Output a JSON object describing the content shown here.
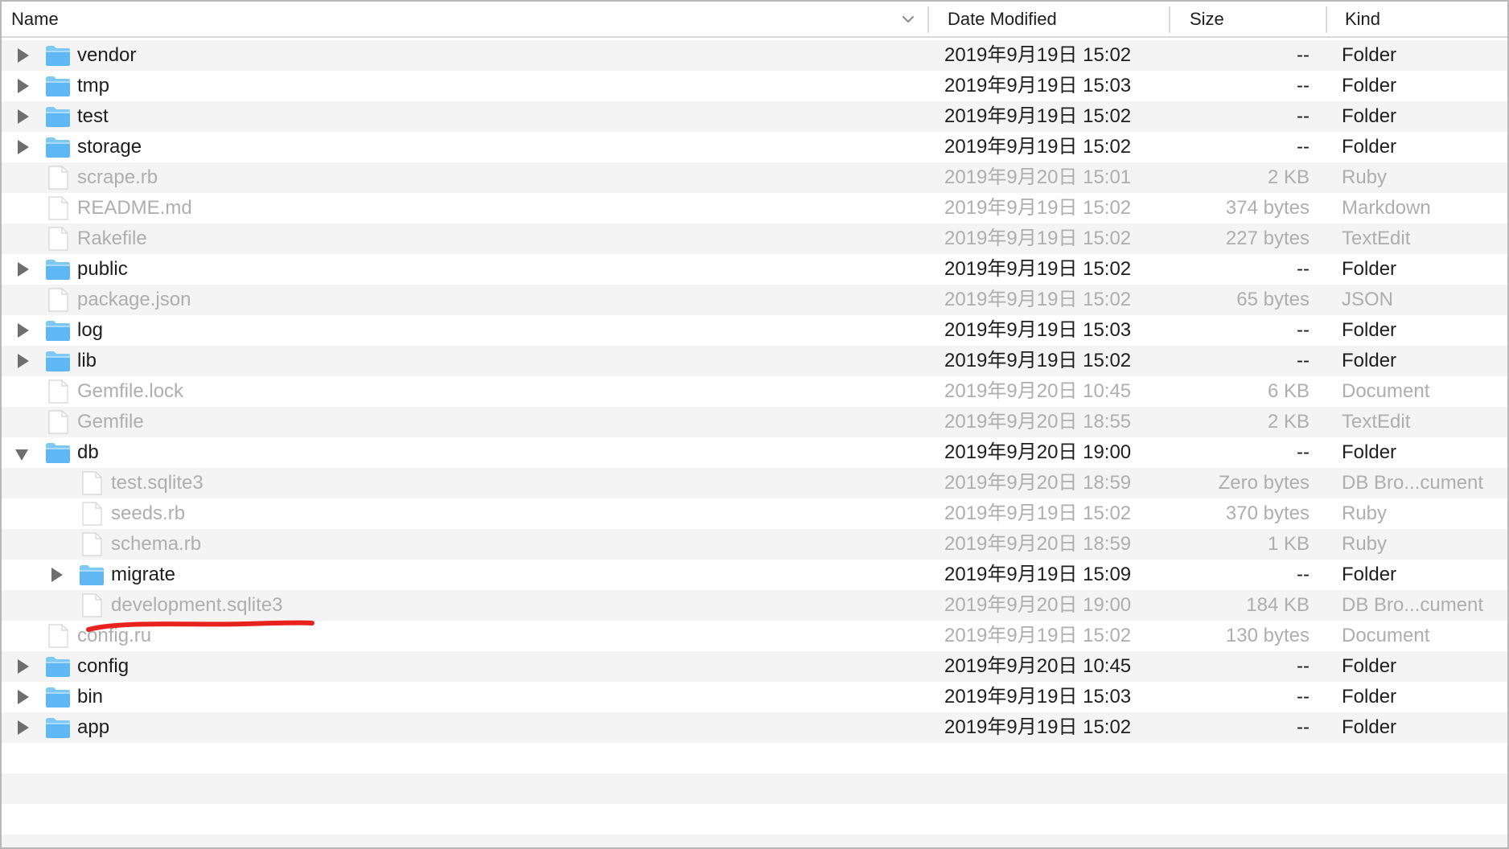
{
  "columns": {
    "name": "Name",
    "date_modified": "Date Modified",
    "size": "Size",
    "kind": "Kind"
  },
  "colors": {
    "folder": "#5fb8f3",
    "folder_tab": "#7ec8f6",
    "row_stripe": "#f4f4f4",
    "dimmed_text": "#aeaeae",
    "annotation": "#e8231d"
  },
  "rows": [
    {
      "name": "vendor",
      "date": "2019年9月19日 15:02",
      "size": "--",
      "kind": "Folder",
      "type": "folder",
      "level": 0,
      "expanded": false,
      "dim": false
    },
    {
      "name": "tmp",
      "date": "2019年9月19日 15:03",
      "size": "--",
      "kind": "Folder",
      "type": "folder",
      "level": 0,
      "expanded": false,
      "dim": false
    },
    {
      "name": "test",
      "date": "2019年9月19日 15:02",
      "size": "--",
      "kind": "Folder",
      "type": "folder",
      "level": 0,
      "expanded": false,
      "dim": false
    },
    {
      "name": "storage",
      "date": "2019年9月19日 15:02",
      "size": "--",
      "kind": "Folder",
      "type": "folder",
      "level": 0,
      "expanded": false,
      "dim": false
    },
    {
      "name": "scrape.rb",
      "date": "2019年9月20日 15:01",
      "size": "2 KB",
      "kind": "Ruby",
      "type": "file",
      "level": 0,
      "dim": true
    },
    {
      "name": "README.md",
      "date": "2019年9月19日 15:02",
      "size": "374 bytes",
      "kind": "Markdown",
      "type": "file",
      "level": 0,
      "dim": true
    },
    {
      "name": "Rakefile",
      "date": "2019年9月19日 15:02",
      "size": "227 bytes",
      "kind": "TextEdit",
      "type": "file",
      "level": 0,
      "dim": true
    },
    {
      "name": "public",
      "date": "2019年9月19日 15:02",
      "size": "--",
      "kind": "Folder",
      "type": "folder",
      "level": 0,
      "expanded": false,
      "dim": false
    },
    {
      "name": "package.json",
      "date": "2019年9月19日 15:02",
      "size": "65 bytes",
      "kind": "JSON",
      "type": "file",
      "level": 0,
      "dim": true
    },
    {
      "name": "log",
      "date": "2019年9月19日 15:03",
      "size": "--",
      "kind": "Folder",
      "type": "folder",
      "level": 0,
      "expanded": false,
      "dim": false
    },
    {
      "name": "lib",
      "date": "2019年9月19日 15:02",
      "size": "--",
      "kind": "Folder",
      "type": "folder",
      "level": 0,
      "expanded": false,
      "dim": false
    },
    {
      "name": "Gemfile.lock",
      "date": "2019年9月20日 10:45",
      "size": "6 KB",
      "kind": "Document",
      "type": "file",
      "level": 0,
      "dim": true
    },
    {
      "name": "Gemfile",
      "date": "2019年9月20日 18:55",
      "size": "2 KB",
      "kind": "TextEdit",
      "type": "file",
      "level": 0,
      "dim": true
    },
    {
      "name": "db",
      "date": "2019年9月20日 19:00",
      "size": "--",
      "kind": "Folder",
      "type": "folder",
      "level": 0,
      "expanded": true,
      "dim": false
    },
    {
      "name": "test.sqlite3",
      "date": "2019年9月20日 18:59",
      "size": "Zero bytes",
      "kind": "DB Bro...cument",
      "type": "file",
      "level": 1,
      "dim": true
    },
    {
      "name": "seeds.rb",
      "date": "2019年9月19日 15:02",
      "size": "370 bytes",
      "kind": "Ruby",
      "type": "file",
      "level": 1,
      "dim": true
    },
    {
      "name": "schema.rb",
      "date": "2019年9月20日 18:59",
      "size": "1 KB",
      "kind": "Ruby",
      "type": "file",
      "level": 1,
      "dim": true
    },
    {
      "name": "migrate",
      "date": "2019年9月19日 15:09",
      "size": "--",
      "kind": "Folder",
      "type": "folder",
      "level": 1,
      "expanded": false,
      "dim": false
    },
    {
      "name": "development.sqlite3",
      "date": "2019年9月20日 19:00",
      "size": "184 KB",
      "kind": "DB Bro...cument",
      "type": "file",
      "level": 1,
      "dim": true,
      "annotated": true
    },
    {
      "name": "config.ru",
      "date": "2019年9月19日 15:02",
      "size": "130 bytes",
      "kind": "Document",
      "type": "file",
      "level": 0,
      "dim": true
    },
    {
      "name": "config",
      "date": "2019年9月20日 10:45",
      "size": "--",
      "kind": "Folder",
      "type": "folder",
      "level": 0,
      "expanded": false,
      "dim": false
    },
    {
      "name": "bin",
      "date": "2019年9月19日 15:03",
      "size": "--",
      "kind": "Folder",
      "type": "folder",
      "level": 0,
      "expanded": false,
      "dim": false
    },
    {
      "name": "app",
      "date": "2019年9月19日 15:02",
      "size": "--",
      "kind": "Folder",
      "type": "folder",
      "level": 0,
      "expanded": false,
      "dim": false
    }
  ]
}
